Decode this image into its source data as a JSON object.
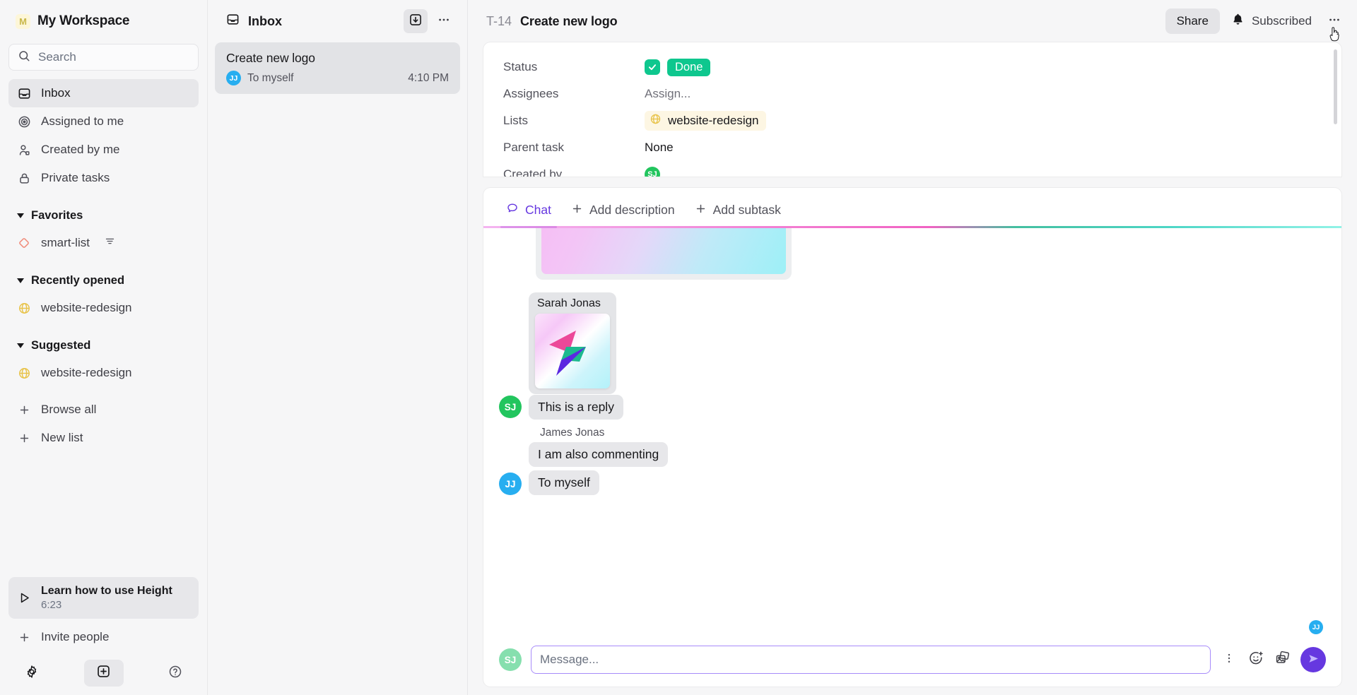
{
  "sidebar": {
    "workspace": {
      "initial": "M",
      "name": "My Workspace"
    },
    "search": {
      "placeholder": "Search",
      "icon": "search-icon"
    },
    "nav": [
      {
        "label": "Inbox",
        "icon": "inbox-icon",
        "active": true
      },
      {
        "label": "Assigned to me",
        "icon": "target-icon",
        "active": false
      },
      {
        "label": "Created by me",
        "icon": "user-icon",
        "active": false
      },
      {
        "label": "Private tasks",
        "icon": "lock-icon",
        "active": false
      }
    ],
    "sections": [
      {
        "title": "Favorites",
        "items": [
          {
            "label": "smart-list",
            "icon": "diamond-icon",
            "suffix_icon": "filter-icon"
          }
        ]
      },
      {
        "title": "Recently opened",
        "items": [
          {
            "label": "website-redesign",
            "icon": "globe-icon",
            "suffix_icon": ""
          }
        ]
      },
      {
        "title": "Suggested",
        "items": [
          {
            "label": "website-redesign",
            "icon": "globe-icon",
            "suffix_icon": ""
          }
        ]
      }
    ],
    "actions": [
      {
        "label": "Browse all",
        "icon": "plus-icon"
      },
      {
        "label": "New list",
        "icon": "plus-icon"
      }
    ],
    "learn_card": {
      "title": "Learn how to use Height",
      "duration": "6:23",
      "icon": "play-icon"
    },
    "invite": {
      "label": "Invite people",
      "icon": "plus-icon"
    },
    "footer": [
      {
        "name": "settings-button",
        "icon": "gear-icon"
      },
      {
        "name": "new-item-button",
        "icon": "plus-box-icon"
      },
      {
        "name": "help-button",
        "icon": "question-icon"
      }
    ]
  },
  "list_pane": {
    "title": "Inbox",
    "title_icon": "inbox-icon",
    "actions": [
      {
        "name": "archive-button",
        "icon": "archive-down-icon"
      },
      {
        "name": "more-options-button",
        "icon": "more-horizontal-icon"
      }
    ],
    "tasks": [
      {
        "title": "Create new logo",
        "avatar_initials": "JJ",
        "avatar_color": "#27aef0",
        "subtitle": "To myself",
        "time": "4:10 PM"
      }
    ]
  },
  "detail": {
    "task_key": "T-14",
    "task_title": "Create new logo",
    "share_label": "Share",
    "subscribed_label": "Subscribed",
    "bell_icon": "bell-icon",
    "more_icon": "more-horizontal-icon",
    "properties": [
      {
        "label": "Status",
        "value": "Done",
        "type": "status"
      },
      {
        "label": "Assignees",
        "value": "Assign...",
        "type": "placeholder"
      },
      {
        "label": "Lists",
        "value": "website-redesign",
        "type": "list-chip",
        "icon": "globe-icon"
      },
      {
        "label": "Parent task",
        "value": "None",
        "type": "text"
      },
      {
        "label": "Created by",
        "value": "",
        "type": "avatar",
        "avatar_initials": "SJ",
        "avatar_color": "#22c55e"
      }
    ],
    "status_color": "#0ec78e",
    "accent_color": "#6638e0",
    "tabs": [
      {
        "label": "Chat",
        "icon": "chat-icon",
        "active": true
      },
      {
        "label": "Add description",
        "icon": "plus-icon",
        "active": false
      },
      {
        "label": "Add subtask",
        "icon": "plus-icon",
        "active": false
      }
    ],
    "messages": [
      {
        "kind": "image",
        "sender": "",
        "avatar_initials": "",
        "avatar_color": "",
        "text": ""
      },
      {
        "kind": "reply",
        "sender": "Sarah Jonas",
        "avatar_initials": "SJ",
        "avatar_color": "#22c55e",
        "text": "This is a reply"
      },
      {
        "kind": "text",
        "sender": "James Jonas",
        "avatar_initials": "JJ",
        "avatar_color": "#27aef0",
        "text": "I am also commenting"
      },
      {
        "kind": "text",
        "sender": "",
        "avatar_initials": "JJ",
        "avatar_color": "#27aef0",
        "text": "To myself"
      }
    ],
    "read_receipt": {
      "initials": "JJ",
      "color": "#27aef0"
    },
    "composer": {
      "avatar_initials": "SJ",
      "avatar_color": "#86dfae",
      "placeholder": "Message...",
      "icons": [
        {
          "name": "more-vertical-button",
          "icon": "more-vertical-icon"
        },
        {
          "name": "emoji-button",
          "icon": "emoji-plus-icon"
        },
        {
          "name": "gif-button",
          "icon": "images-icon"
        }
      ],
      "send_icon": "send-icon"
    }
  }
}
